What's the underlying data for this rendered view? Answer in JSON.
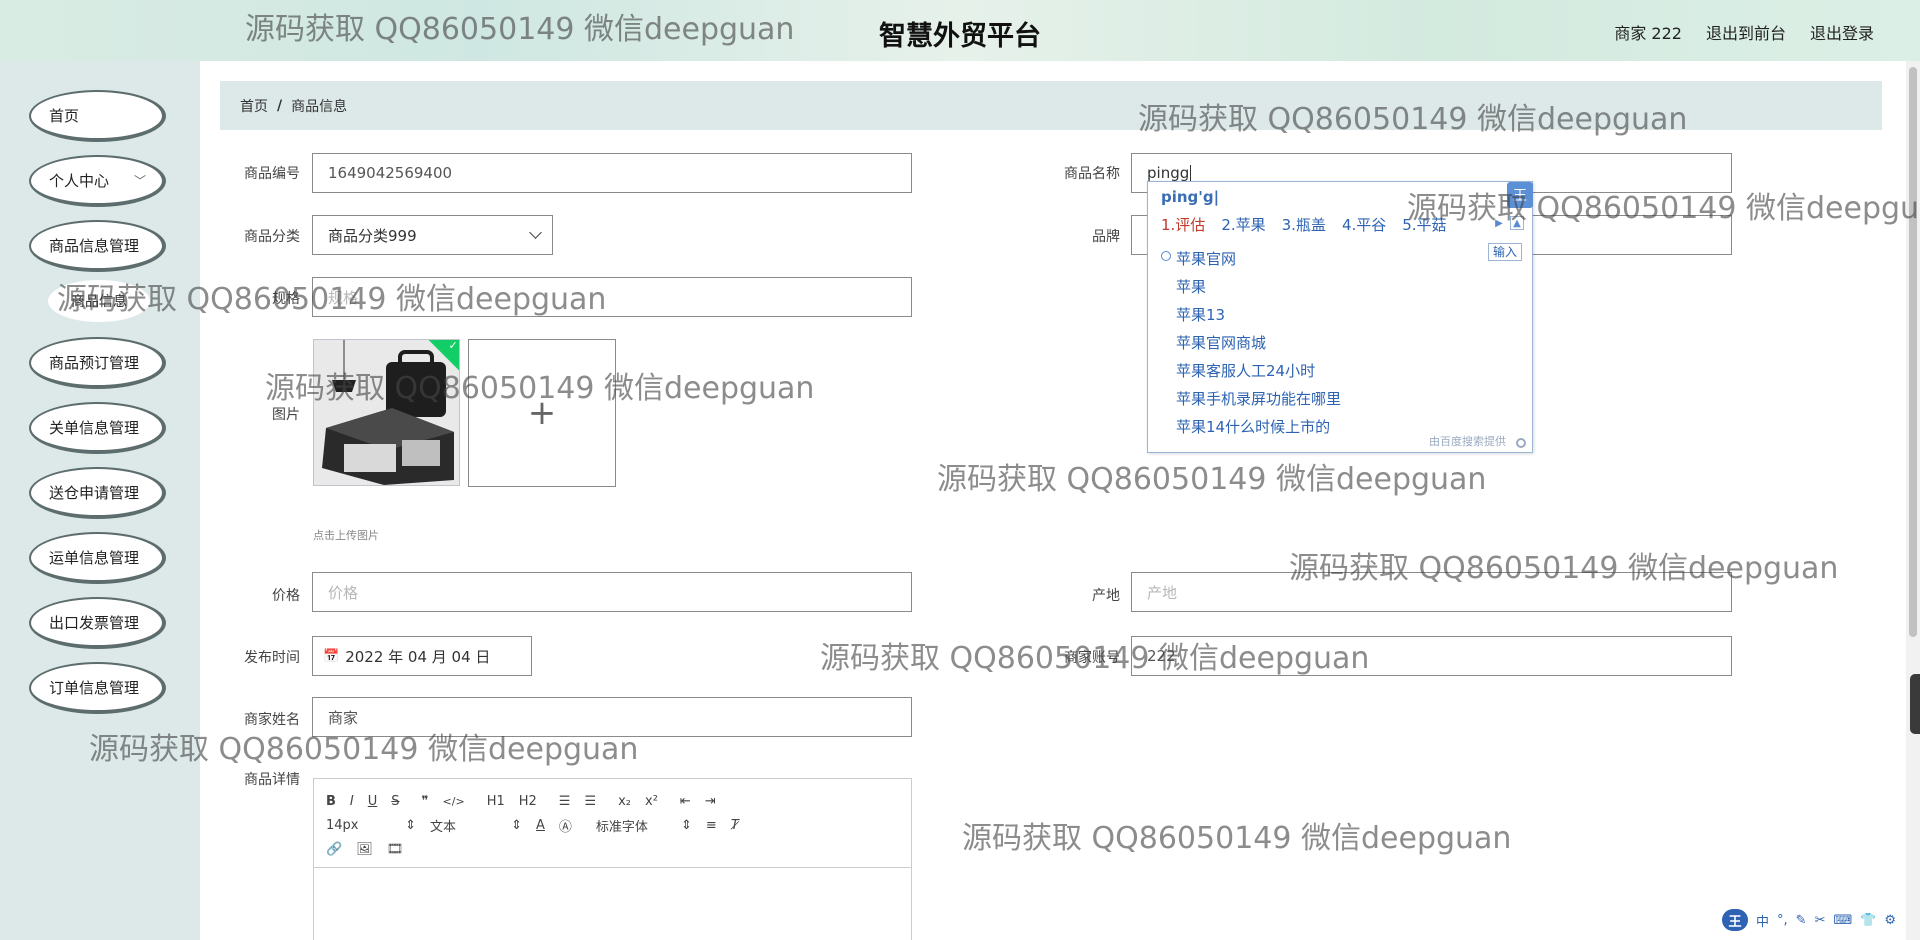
{
  "header": {
    "title": "智慧外贸平台",
    "user": "商家 222",
    "to_front": "退出到前台",
    "logout": "退出登录"
  },
  "sidebar": {
    "items": [
      {
        "label": "首页"
      },
      {
        "label": "个人中心"
      },
      {
        "label": "商品信息管理"
      },
      {
        "label": "商品信息"
      },
      {
        "label": "商品预订管理"
      },
      {
        "label": "关单信息管理"
      },
      {
        "label": "送仓申请管理"
      },
      {
        "label": "运单信息管理"
      },
      {
        "label": "出口发票管理"
      },
      {
        "label": "订单信息管理"
      }
    ]
  },
  "breadcrumb": {
    "home": "首页",
    "current": "商品信息"
  },
  "form": {
    "product_no": {
      "label": "商品编号",
      "value": "1649042569400"
    },
    "product_name": {
      "label": "商品名称",
      "value": "pingg"
    },
    "category": {
      "label": "商品分类",
      "value": "商品分类999"
    },
    "brand": {
      "label": "品牌",
      "value": ""
    },
    "spec": {
      "label": "规格",
      "placeholder": "规格"
    },
    "image": {
      "label": "图片",
      "hint": "点击上传图片"
    },
    "price": {
      "label": "价格",
      "placeholder": "价格"
    },
    "origin": {
      "label": "产地",
      "placeholder": "产地"
    },
    "publish_time": {
      "label": "发布时间",
      "value": "2022 年 04 月 04 日"
    },
    "merchant_account": {
      "label": "商家账号",
      "value": "222"
    },
    "merchant_name": {
      "label": "商家姓名",
      "value": "商家"
    },
    "detail": {
      "label": "商品详情"
    }
  },
  "editor": {
    "font_size": "14px",
    "text_type": "文本",
    "font_family": "标准字体",
    "buttons": [
      "B",
      "I",
      "U",
      "S",
      "❞",
      "</>",
      "H1",
      "H2",
      "ol",
      "ul",
      "x₂",
      "x²",
      "outdent",
      "indent"
    ]
  },
  "ime": {
    "pinyin": "ping'g|",
    "candidates": [
      "1.评估",
      "2.苹果",
      "3.瓶盖",
      "4.平谷",
      "5.平菇"
    ],
    "input_btn": "输入",
    "suggestions": [
      "苹果官网",
      "苹果",
      "苹果13",
      "苹果官网商城",
      "苹果客服人工24小时",
      "苹果手机录屏功能在哪里",
      "苹果14什么时候上市的"
    ],
    "footer": "由百度搜索提供",
    "logo": "王"
  },
  "imebar": {
    "logo": "王",
    "mode": "中"
  },
  "watermark": "源码获取 QQ86050149 微信deepguan",
  "colors": {
    "sidebar_bg": "#dde9e9",
    "menu_border": "#5d6d6d",
    "ime_blue": "#2d63b2",
    "check_green": "#13ce66"
  }
}
